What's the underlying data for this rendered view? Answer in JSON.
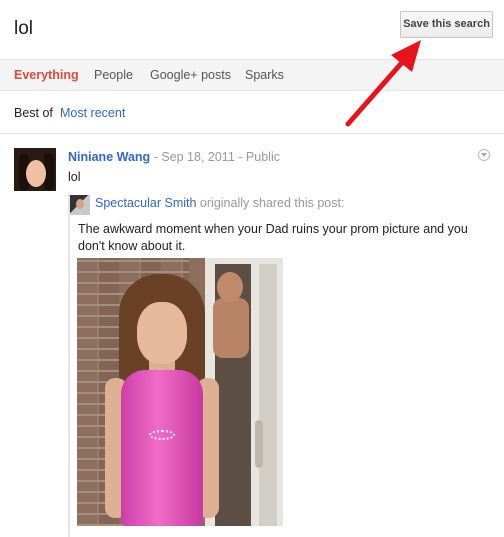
{
  "search": {
    "query": "lol",
    "save_button": "Save this search"
  },
  "tabs": [
    {
      "label": "Everything",
      "active": true
    },
    {
      "label": "People",
      "active": false
    },
    {
      "label": "Google+ posts",
      "active": false
    },
    {
      "label": "Sparks",
      "active": false
    }
  ],
  "filter": {
    "label": "Best of",
    "link": "Most recent"
  },
  "post": {
    "author": "Niniane Wang",
    "date": "Sep 18, 2011",
    "visibility": "Public",
    "sep": "-",
    "text": "lol",
    "reshare": {
      "author": "Spectacular Smith",
      "suffix": "originally shared this post:",
      "text": "The awkward moment when your Dad ruins your prom picture and you don't know about it."
    }
  },
  "icons": {
    "post_menu": "chevron-down-circle-icon",
    "arrow": "red-arrow-annotation"
  },
  "colors": {
    "accent_red": "#dd4b39",
    "link_blue": "#3366cc",
    "arrow_red": "#e8141c"
  }
}
